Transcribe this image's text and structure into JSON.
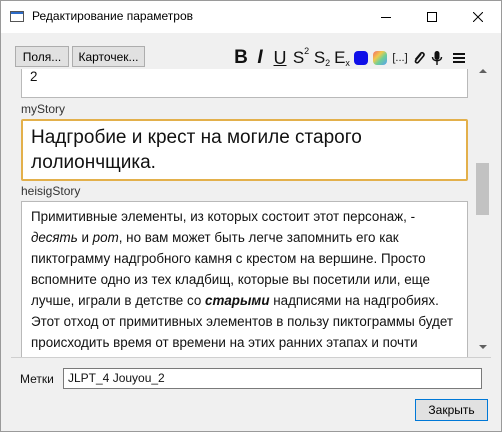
{
  "window": {
    "title": "Редактирование параметров"
  },
  "toolbar": {
    "fields_label": "Поля...",
    "cards_label": "Карточек...",
    "bold": "B",
    "italic": "I",
    "underline": "U",
    "superscript": "S",
    "superscript_mark": "2",
    "subscript": "S",
    "subscript_mark": "2",
    "clear_format": "E",
    "clear_format_mark": "x",
    "cloze_label": "[...]",
    "font_color": "#1010e8"
  },
  "field_top": {
    "value": "2"
  },
  "my_story": {
    "label": "myStory",
    "value": "Надгробие и крест на могиле старого лолиончщика."
  },
  "heisig_story": {
    "label": "heisigStory",
    "segments": [
      {
        "t": "Примитивные элементы, из которых состоит этот персонаж, - ",
        "s": "n"
      },
      {
        "t": "десять",
        "s": "i"
      },
      {
        "t": " и ",
        "s": "n"
      },
      {
        "t": "рот",
        "s": "i"
      },
      {
        "t": ", но вам может быть легче запомнить его как пиктограмму надгробного камня с крестом на вершине. Просто вспомните одно из тех кладбищ, которые вы посетили или, еще лучше, играли в детстве со ",
        "s": "n"
      },
      {
        "t": "старыми",
        "s": "bi"
      },
      {
        "t": " надписями на надгробиях. Этот отход от примитивных элементов в пользу пиктограммы будет происходить время от времени на этих ранних этапах и почти никогда после этого. Так что вам не нужно беспокоиться о",
        "s": "n"
      }
    ]
  },
  "tags": {
    "label": "Метки",
    "value": "JLPT_4 Jouyou_2"
  },
  "close_button": "Закрыть"
}
